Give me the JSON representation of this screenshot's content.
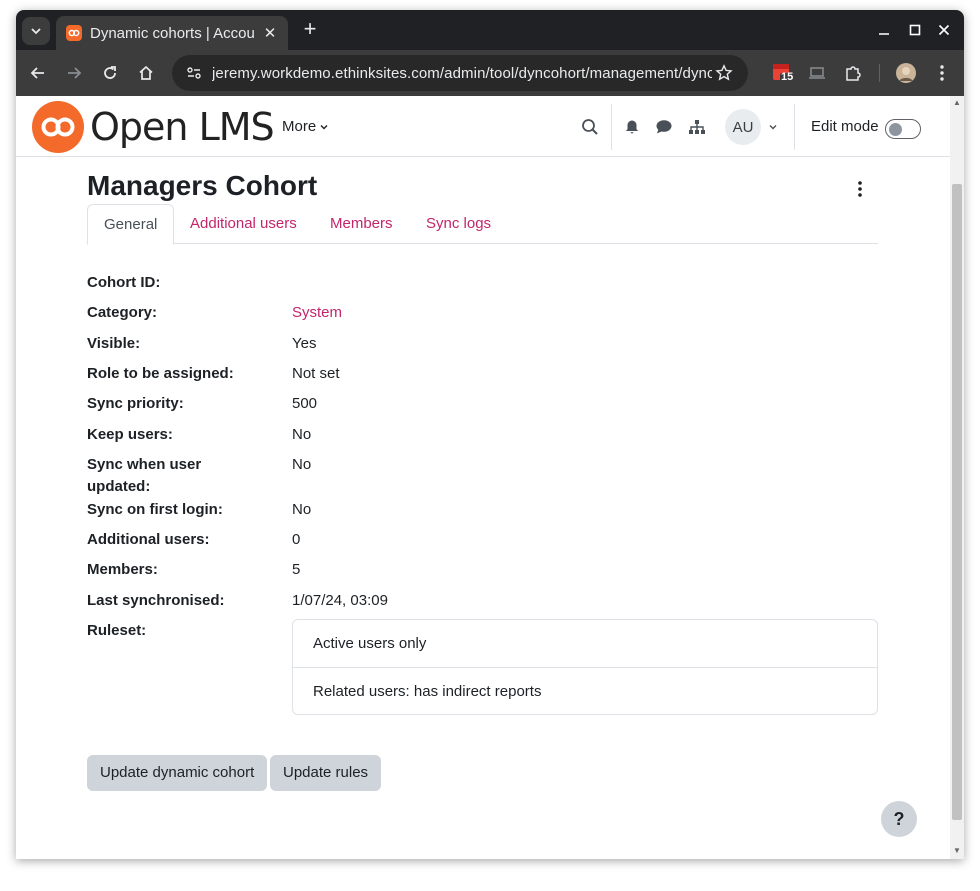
{
  "browser": {
    "tab_title": "Dynamic cohorts | Account",
    "url": "jeremy.workdemo.ethinksites.com/admin/tool/dyncohort/management/dynco…",
    "calendar_badge": "15"
  },
  "navbar": {
    "logo_text": "Open LMS",
    "more_label": "More",
    "avatar_initials": "AU",
    "edit_mode_label": "Edit mode",
    "edit_mode_on": false
  },
  "page": {
    "title": "Managers Cohort",
    "tabs": [
      {
        "label": "General",
        "active": true
      },
      {
        "label": "Additional users",
        "active": false
      },
      {
        "label": "Members",
        "active": false
      },
      {
        "label": "Sync logs",
        "active": false
      }
    ],
    "details": [
      {
        "label": "Cohort ID:",
        "value": ""
      },
      {
        "label": "Category:",
        "value": "System"
      },
      {
        "label": "Visible:",
        "value": "Yes"
      },
      {
        "label": "Role to be assigned:",
        "value": "Not set"
      },
      {
        "label": "Sync priority:",
        "value": "500"
      },
      {
        "label": "Keep users:",
        "value": "No"
      },
      {
        "label": "Sync when user updated:",
        "value": "No"
      },
      {
        "label": "Sync on first login:",
        "value": "No"
      },
      {
        "label": "Additional users:",
        "value": "0"
      },
      {
        "label": "Members:",
        "value": "5"
      },
      {
        "label": "Last synchronised:",
        "value": "1/07/24, 03:09"
      },
      {
        "label": "Ruleset:",
        "value": ""
      }
    ],
    "ruleset": [
      "Active users only",
      "Related users: has indirect reports"
    ],
    "buttons": {
      "update_cohort": "Update dynamic cohort",
      "update_rules": "Update rules"
    },
    "help_label": "?"
  },
  "colors": {
    "link": "#c3256b",
    "brand": "#f36a2b",
    "button_bg": "#ced4da"
  }
}
